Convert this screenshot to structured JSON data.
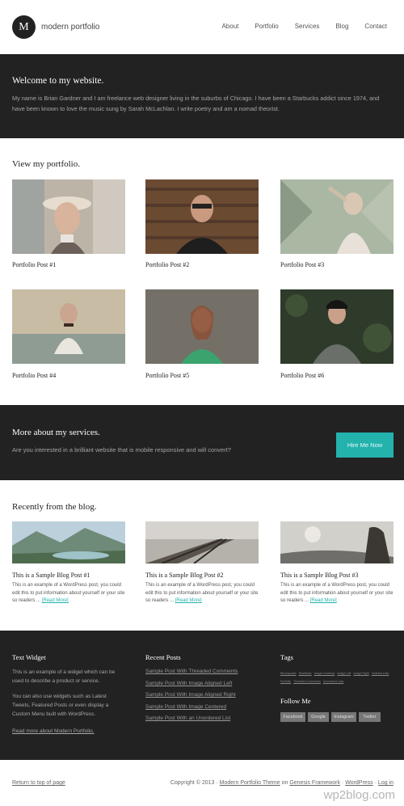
{
  "header": {
    "logo_letter": "M",
    "site_title": "modern portfolio",
    "nav": [
      "About",
      "Portfolio",
      "Services",
      "Blog",
      "Contact"
    ]
  },
  "welcome": {
    "title": "Welcome to my website.",
    "text": "My name is Brian Gardner and I am freelance web designer living in the suburbs of Chicago. I have been a Starbucks addict since 1974, and have been known to love the music sung by Sarah McLachlan. I write poetry and am a nomad theorist."
  },
  "portfolio": {
    "title": "View my portfolio.",
    "posts": [
      "Portfolio Post #1",
      "Portfolio Post #2",
      "Portfolio Post #3",
      "Portfolio Post #4",
      "Portfolio Post #5",
      "Portfolio Post #6"
    ]
  },
  "services": {
    "title": "More about my services.",
    "text": "Are you interested in a brilliant website that is mobile responsive and will convert?",
    "button": "Hire Me Now"
  },
  "blog": {
    "title": "Recently from the blog.",
    "posts": [
      {
        "title": "This is a Sample Blog Post #1",
        "excerpt": "This is an example of a WordPress post, you could edit this to put information about yourself or your site so readers ...",
        "more": "[Read More]"
      },
      {
        "title": "This is a Sample Blog Post #2",
        "excerpt": "This is an example of a WordPress post, you could edit this to put information about yourself or your site so readers ...",
        "more": "[Read More]"
      },
      {
        "title": "This is a Sample Blog Post #3",
        "excerpt": "This is an example of a WordPress post, you could edit this to put information about yourself or your site so readers ...",
        "more": "[Read More]"
      }
    ]
  },
  "widgets": {
    "text_widget": {
      "title": "Text Widget",
      "p1": "This is an example of a widget which can be used to describe a product or service.",
      "p2": "You can also use widgets such as Latest Tweets, Featured Posts or even display a Custom Menu built with WordPress.",
      "link": "Read more about Modern Portfolio."
    },
    "recent_posts": {
      "title": "Recent Posts",
      "items": [
        "Sample Post With Threaded Comments",
        "Sample Post With Image Aligned Left",
        "Sample Post With Image Aligned Right",
        "Sample Post With Image Centered",
        "Sample Post With an Unordered List"
      ]
    },
    "tags": {
      "title": "Tags",
      "items": [
        "Blockquotes",
        "Headlines",
        "Image Centered",
        "Image Left",
        "Image Right",
        "Ordered Lists",
        "Portfolio",
        "Threaded Comments",
        "Unordered Lists"
      ]
    },
    "follow": {
      "title": "Follow Me",
      "items": [
        "Facebook",
        "Google",
        "Instagram",
        "Twitter"
      ]
    }
  },
  "footer": {
    "back_to_top": "Return to top of page",
    "copyright": "Copyright © 2013 · ",
    "theme": "Modern Portfolio Theme",
    "on": " on ",
    "framework": "Genesis Framework",
    "sep1": " · ",
    "wordpress": "WordPress",
    "sep2": " · ",
    "login": "Log in",
    "watermark": "wp2blog.com"
  },
  "colors": {
    "dark": "#222222",
    "accent": "#24b2ad"
  }
}
